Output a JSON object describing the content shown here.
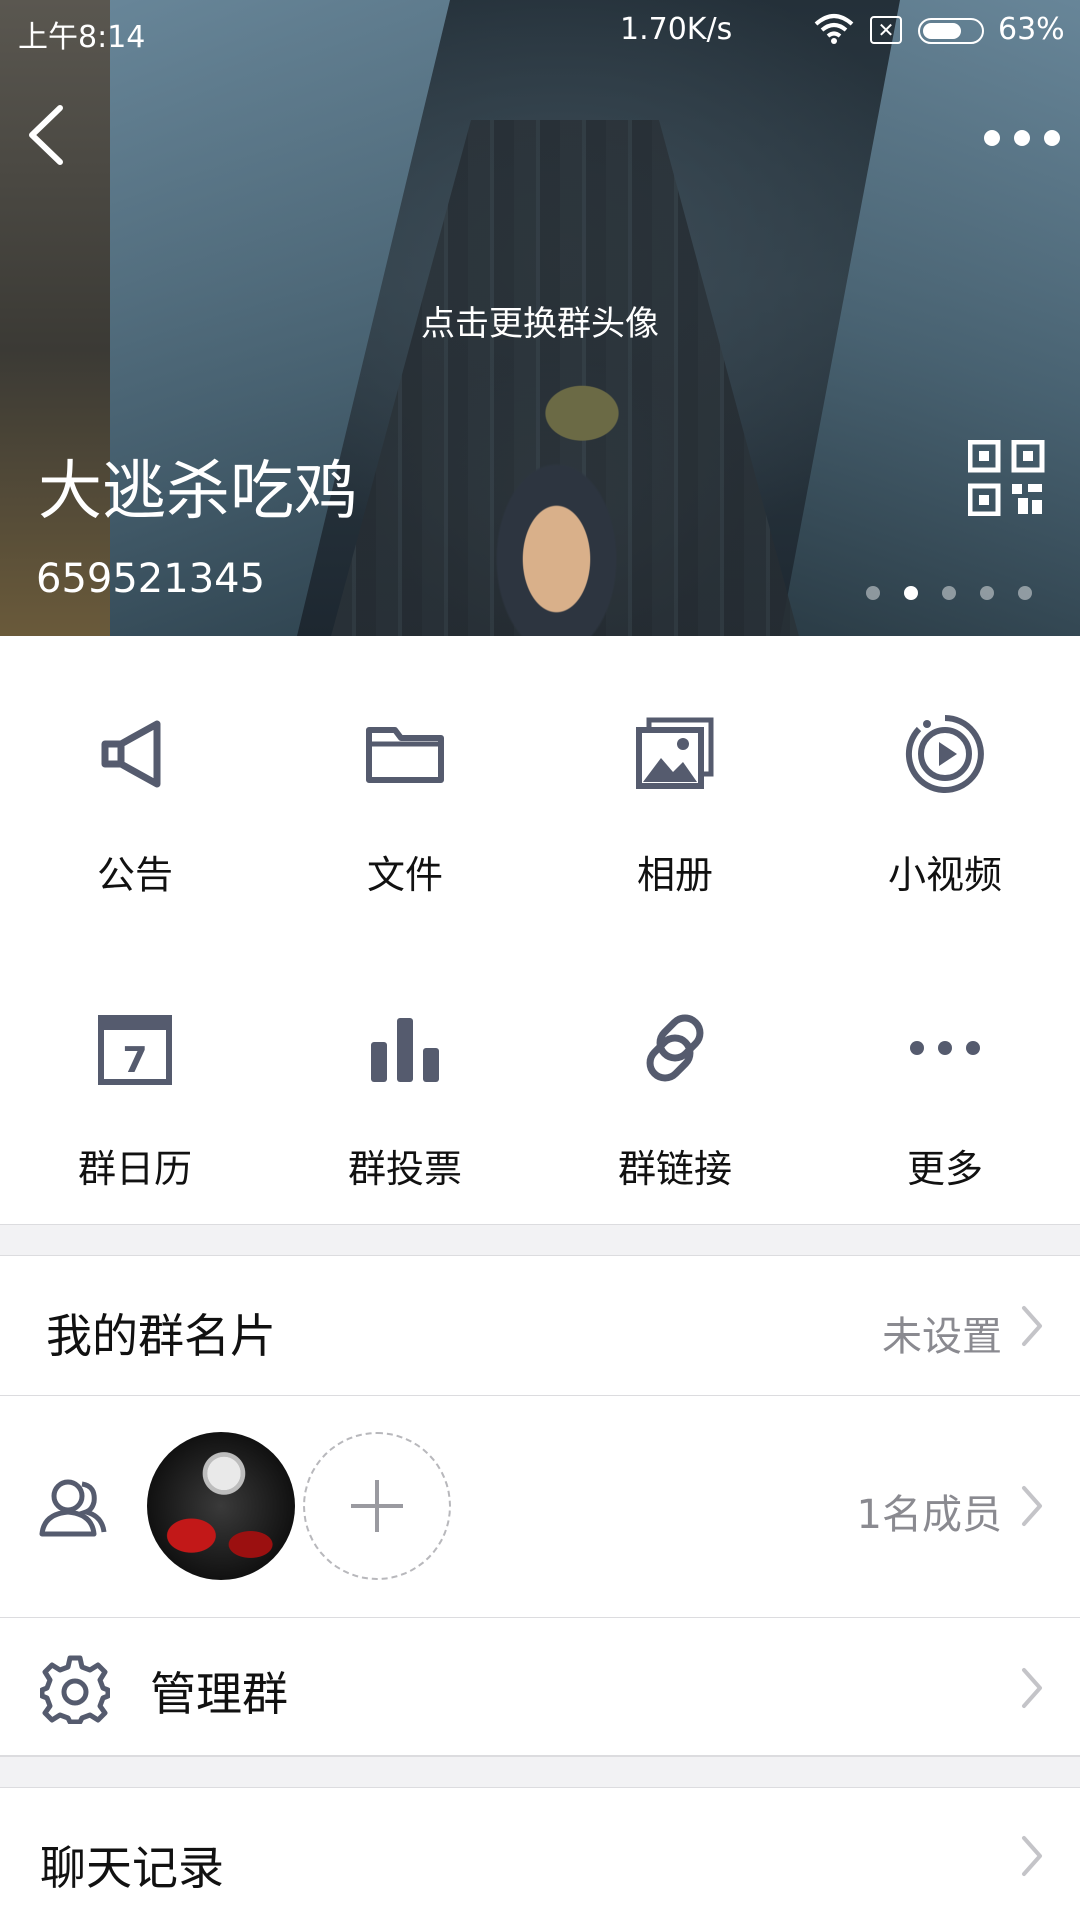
{
  "status_bar": {
    "time": "上午8:14",
    "speed": "1.70K/s",
    "battery": "63%"
  },
  "header": {
    "cover_hint": "点击更换群头像",
    "group_name": "大逃杀吃鸡",
    "group_id": "659521345",
    "page_dots": {
      "count": 5,
      "active_index": 1
    }
  },
  "grid": {
    "items": [
      {
        "label": "公告",
        "icon": "megaphone-icon"
      },
      {
        "label": "文件",
        "icon": "folder-icon"
      },
      {
        "label": "相册",
        "icon": "photo-album-icon"
      },
      {
        "label": "小视频",
        "icon": "video-play-icon"
      },
      {
        "label": "群日历",
        "icon": "calendar-icon",
        "calendar_day": "7"
      },
      {
        "label": "群投票",
        "icon": "bar-chart-icon"
      },
      {
        "label": "群链接",
        "icon": "link-icon"
      },
      {
        "label": "更多",
        "icon": "more-dots-icon"
      }
    ]
  },
  "rows": {
    "group_card": {
      "title": "我的群名片",
      "value": "未设置"
    },
    "members": {
      "value": "1名成员"
    },
    "manage": {
      "title": "管理群"
    },
    "chat_history": {
      "title": "聊天记录"
    }
  },
  "colors": {
    "icon_gray": "#555b6e",
    "value_gray": "#8a8a90",
    "separator": "#f2f2f4"
  }
}
